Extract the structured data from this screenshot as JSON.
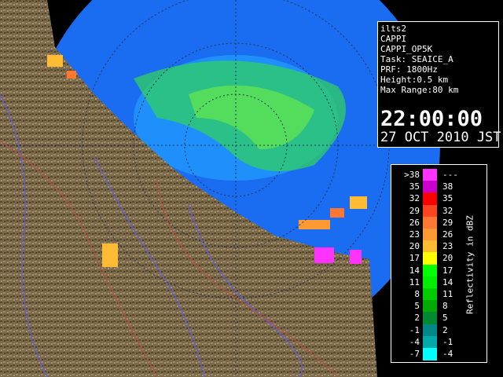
{
  "info_panel": {
    "station": "ilts2",
    "product": "CAPPI",
    "product_id": "CAPPI_OP5K",
    "task": "Task: SEAICE_A",
    "prf": "PRF: 1800Hz",
    "height": "Height:0.5 km",
    "max_range": "Max Range:80 km",
    "time": "22:00:00",
    "date": "27 OCT 2010 JST"
  },
  "legend": {
    "title": "Reflectivity in dBZ",
    "rows": [
      {
        "low": ">38",
        "high": "---",
        "color": "#ff33ff"
      },
      {
        "low": "35",
        "high": "38",
        "color": "#cc00cc"
      },
      {
        "low": "32",
        "high": "35",
        "color": "#ff0000"
      },
      {
        "low": "29",
        "high": "32",
        "color": "#ff4422"
      },
      {
        "low": "26",
        "high": "29",
        "color": "#ff7733"
      },
      {
        "low": "23",
        "high": "26",
        "color": "#ff9933"
      },
      {
        "low": "20",
        "high": "23",
        "color": "#ffbb33"
      },
      {
        "low": "17",
        "high": "20",
        "color": "#ffff00"
      },
      {
        "low": "14",
        "high": "17",
        "color": "#00ff00"
      },
      {
        "low": "11",
        "high": "14",
        "color": "#00ee00"
      },
      {
        "low": "8",
        "high": "11",
        "color": "#00cc00"
      },
      {
        "low": "5",
        "high": "8",
        "color": "#00aa00"
      },
      {
        "low": "2",
        "high": "5",
        "color": "#008833"
      },
      {
        "low": "-1",
        "high": "2",
        "color": "#008888"
      },
      {
        "low": "-4",
        "high": "-1",
        "color": "#00aaaa"
      },
      {
        "low": "-7",
        "high": "-4",
        "color": "#00ffff"
      }
    ]
  },
  "colors": {
    "sea": "#1a6cf0",
    "land": "#7b6a4a",
    "clear_air_echo": "#2a7ff8",
    "rivers": "#5a5aff",
    "borders": "#c04a4a"
  }
}
